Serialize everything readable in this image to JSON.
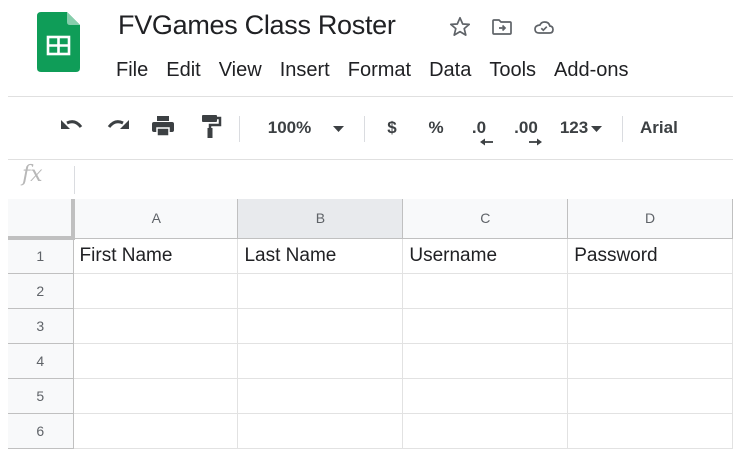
{
  "document": {
    "title": "FVGames Class Roster"
  },
  "title_icons": [
    "star-icon",
    "move-to-folder-icon",
    "cloud-status-icon"
  ],
  "menu": [
    "File",
    "Edit",
    "View",
    "Insert",
    "Format",
    "Data",
    "Tools",
    "Add-ons"
  ],
  "toolbar": {
    "zoom": "100%",
    "currency": "$",
    "percent": "%",
    "decrease_decimal": ".0",
    "increase_decimal": ".00",
    "more_formats": "123",
    "font": "Arial"
  },
  "formula_bar": {
    "label": "fx",
    "value": ""
  },
  "sheet": {
    "columns": [
      "A",
      "B",
      "C",
      "D"
    ],
    "rows": [
      {
        "num": "1",
        "cells": [
          "First Name",
          "Last Name",
          "Username",
          "Password"
        ]
      },
      {
        "num": "2",
        "cells": [
          "",
          "",
          "",
          ""
        ]
      },
      {
        "num": "3",
        "cells": [
          "",
          "",
          "",
          ""
        ]
      },
      {
        "num": "4",
        "cells": [
          "",
          "",
          "",
          ""
        ]
      },
      {
        "num": "5",
        "cells": [
          "",
          "",
          "",
          ""
        ]
      },
      {
        "num": "6",
        "cells": [
          "",
          "",
          "",
          ""
        ]
      }
    ]
  },
  "colors": {
    "sheets_green": "#0f9d58",
    "header_bg": "#f8f9fa",
    "selected_header_bg": "#e8eaed",
    "grid_line": "#e2e2e2"
  }
}
